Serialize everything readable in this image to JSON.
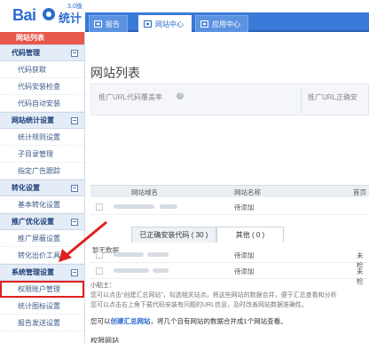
{
  "logo": {
    "text": "Bai",
    "sub": "统计",
    "version": "3.0版"
  },
  "nav": {
    "tabs": [
      {
        "label": "报告",
        "active": false
      },
      {
        "label": "网站中心",
        "active": true
      },
      {
        "label": "应用中心",
        "active": false
      }
    ]
  },
  "sidebar": {
    "header": "网站列表",
    "groups": [
      {
        "title": "代码管理",
        "items": [
          "代码获取",
          "代码安装检查",
          "代码自动安装"
        ]
      },
      {
        "title": "网站统计设置",
        "items": [
          "统计规则设置",
          "子目录管理",
          "指定广告跟踪"
        ]
      },
      {
        "title": "转化设置",
        "items": [
          "基本转化设置"
        ]
      },
      {
        "title": "推广优化设置",
        "items": [
          "推广屏蔽设置",
          "转化出价工具"
        ]
      },
      {
        "title": "系统管理设置",
        "items": [
          "权限账户管理",
          "统计图标设置",
          "报告发送设置"
        ]
      }
    ]
  },
  "main": {
    "title": "网站列表",
    "stats": [
      {
        "label": "推广URL代码覆盖率"
      },
      {
        "label": "推广URL正确安"
      }
    ],
    "table_headers": [
      "网站域名",
      "网站名称",
      "首页"
    ],
    "rows_top": [
      {
        "status": "待添加",
        "extra": ""
      }
    ],
    "subtabs": [
      {
        "label": "已正确安装代码 ( 30 )"
      },
      {
        "label": "其他 ( 0 )"
      }
    ],
    "no_data": "暂无数据",
    "rows_bottom": [
      {
        "status": "待添加",
        "extra": "未检"
      },
      {
        "status": "待添加",
        "extra": "未检"
      }
    ],
    "tips": {
      "title": "小贴士：",
      "line1": "您可以点击“创建汇总网站”，勾选相关站点，将这些网站的数据合并，便于汇总查看和分析",
      "line2": "您可以点击右上角下载代码安装有问题的URL信息，及时改善网站数据准确性。"
    },
    "create": {
      "prefix": "您可以",
      "link": "创建汇总网站",
      "suffix": "，将几个自有网站的数据合并成1个网站查看。"
    },
    "perm_title": "权限网站"
  }
}
